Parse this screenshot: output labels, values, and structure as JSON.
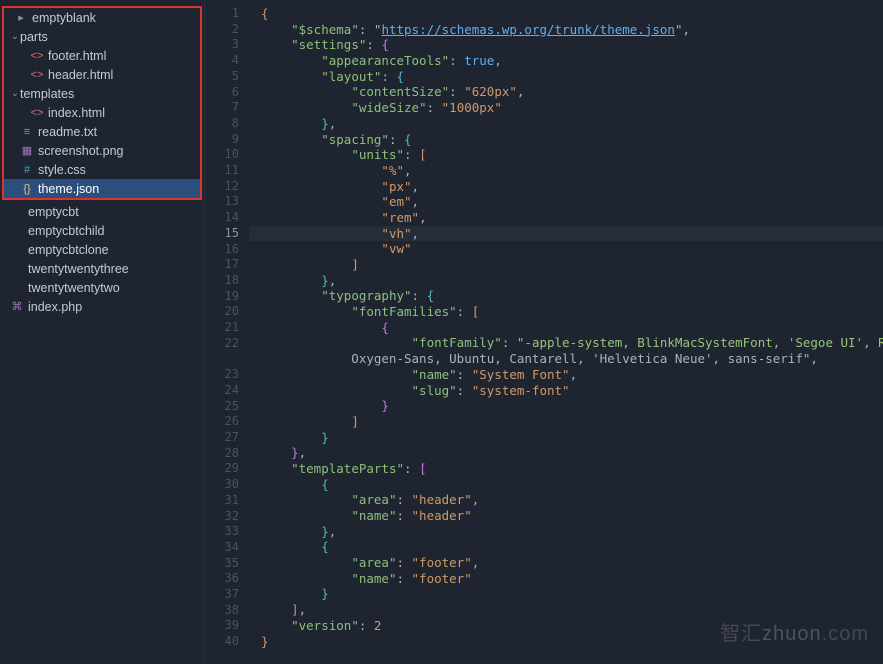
{
  "sidebar": {
    "root": "emptyblank",
    "parts_folder": "parts",
    "templates_folder": "templates",
    "files_in_highlight": [
      {
        "name": "footer.html",
        "icon": "html",
        "depth": 2
      },
      {
        "name": "header.html",
        "icon": "html",
        "depth": 2
      },
      {
        "name": "index.html",
        "icon": "html",
        "depth": 2,
        "underTemplates": true
      },
      {
        "name": "readme.txt",
        "icon": "txt",
        "depth": 1
      },
      {
        "name": "screenshot.png",
        "icon": "png",
        "depth": 1
      },
      {
        "name": "style.css",
        "icon": "css",
        "depth": 1
      },
      {
        "name": "theme.json",
        "icon": "json",
        "depth": 1,
        "selected": true
      }
    ],
    "siblings": [
      "emptycbt",
      "emptycbtchild",
      "emptycbtclone",
      "twentytwentythree",
      "twentytwentytwo",
      "index.php"
    ]
  },
  "editor": {
    "activeLine": 15,
    "lines": [
      {
        "n": 1,
        "html": "<span class='br1'>{</span>"
      },
      {
        "n": 2,
        "html": "    <span class='k'>\"$schema\"</span><span class='p'>: </span><span class='p'>\"</span><span class='url'>https://schemas.wp.org/trunk/theme.json</span><span class='p'>\"</span><span class='p'>,</span>"
      },
      {
        "n": 3,
        "html": "    <span class='k'>\"settings\"</span><span class='p'>: </span><span class='br2'>{</span>"
      },
      {
        "n": 4,
        "html": "        <span class='k'>\"appearanceTools\"</span><span class='p'>: </span><span class='b'>true</span><span class='p'>,</span>"
      },
      {
        "n": 5,
        "html": "        <span class='k'>\"layout\"</span><span class='p'>: </span><span class='br3'>{</span>"
      },
      {
        "n": 6,
        "html": "            <span class='k'>\"contentSize\"</span><span class='p'>: </span><span class='s'>\"620px\"</span><span class='p'>,</span>"
      },
      {
        "n": 7,
        "html": "            <span class='k'>\"wideSize\"</span><span class='p'>: </span><span class='s'>\"1000px\"</span>"
      },
      {
        "n": 8,
        "html": "        <span class='br3'>}</span><span class='p'>,</span>"
      },
      {
        "n": 9,
        "html": "        <span class='k'>\"spacing\"</span><span class='p'>: </span><span class='br3'>{</span>"
      },
      {
        "n": 10,
        "html": "            <span class='k'>\"units\"</span><span class='p'>: </span><span class='br4'>[</span>"
      },
      {
        "n": 11,
        "html": "                <span class='s'>\"%\"</span><span class='p'>,</span>"
      },
      {
        "n": 12,
        "html": "                <span class='s'>\"px\"</span><span class='p'>,</span>"
      },
      {
        "n": 13,
        "html": "                <span class='s'>\"em\"</span><span class='p'>,</span>"
      },
      {
        "n": 14,
        "html": "                <span class='s'>\"rem\"</span><span class='p'>,</span>"
      },
      {
        "n": 15,
        "html": "                <span class='s'>\"vh\"</span><span class='p'>,</span>"
      },
      {
        "n": 16,
        "html": "                <span class='s'>\"vw\"</span>"
      },
      {
        "n": 17,
        "html": "            <span class='br4'>]</span>"
      },
      {
        "n": 18,
        "html": "        <span class='br3'>}</span><span class='p'>,</span>"
      },
      {
        "n": 19,
        "html": "        <span class='k'>\"typography\"</span><span class='p'>: </span><span class='br3'>{</span>"
      },
      {
        "n": 20,
        "html": "            <span class='k'>\"fontFamilies\"</span><span class='p'>: </span><span class='br4'>[</span>"
      },
      {
        "n": 21,
        "html": "                <span class='br5'>{</span>"
      },
      {
        "n": 22,
        "html": "                    <span class='k'>\"fontFamily\"</span><span class='p'>: </span><span class='sg'>\"-apple-system, BlinkMacSystemFont, 'Segoe UI', Roboto,\n            Oxygen-Sans, Ubuntu, Cantarell, 'Helvetica Neue', sans-serif\"</span><span class='p'>,</span>"
      },
      {
        "n": 23,
        "html": "                    <span class='k'>\"name\"</span><span class='p'>: </span><span class='s'>\"System Font\"</span><span class='p'>,</span>"
      },
      {
        "n": 24,
        "html": "                    <span class='k'>\"slug\"</span><span class='p'>: </span><span class='s'>\"system-font\"</span>"
      },
      {
        "n": 25,
        "html": "                <span class='br5'>}</span>"
      },
      {
        "n": 26,
        "html": "            <span class='br4'>]</span>"
      },
      {
        "n": 27,
        "html": "        <span class='br3'>}</span>"
      },
      {
        "n": 28,
        "html": "    <span class='br2'>}</span><span class='p'>,</span>"
      },
      {
        "n": 29,
        "html": "    <span class='k'>\"templateParts\"</span><span class='p'>: </span><span class='br2'>[</span>"
      },
      {
        "n": 30,
        "html": "        <span class='br3'>{</span>"
      },
      {
        "n": 31,
        "html": "            <span class='k'>\"area\"</span><span class='p'>: </span><span class='s'>\"header\"</span><span class='p'>,</span>"
      },
      {
        "n": 32,
        "html": "            <span class='k'>\"name\"</span><span class='p'>: </span><span class='s'>\"header\"</span>"
      },
      {
        "n": 33,
        "html": "        <span class='br3'>}</span><span class='p'>,</span>"
      },
      {
        "n": 34,
        "html": "        <span class='br3'>{</span>"
      },
      {
        "n": 35,
        "html": "            <span class='k'>\"area\"</span><span class='p'>: </span><span class='s'>\"footer\"</span><span class='p'>,</span>"
      },
      {
        "n": 36,
        "html": "            <span class='k'>\"name\"</span><span class='p'>: </span><span class='s'>\"footer\"</span>"
      },
      {
        "n": 37,
        "html": "        <span class='br3'>}</span>"
      },
      {
        "n": 38,
        "html": "    <span class='br2'>]</span><span class='p'>,</span>"
      },
      {
        "n": 39,
        "html": "    <span class='k'>\"version\"</span><span class='p'>: </span><span class='n'>2</span>"
      },
      {
        "n": 40,
        "html": "<span class='br1'>}</span>"
      }
    ]
  },
  "watermark": {
    "text1": "智汇",
    "text2": "zhuon",
    "text3": ".com"
  }
}
